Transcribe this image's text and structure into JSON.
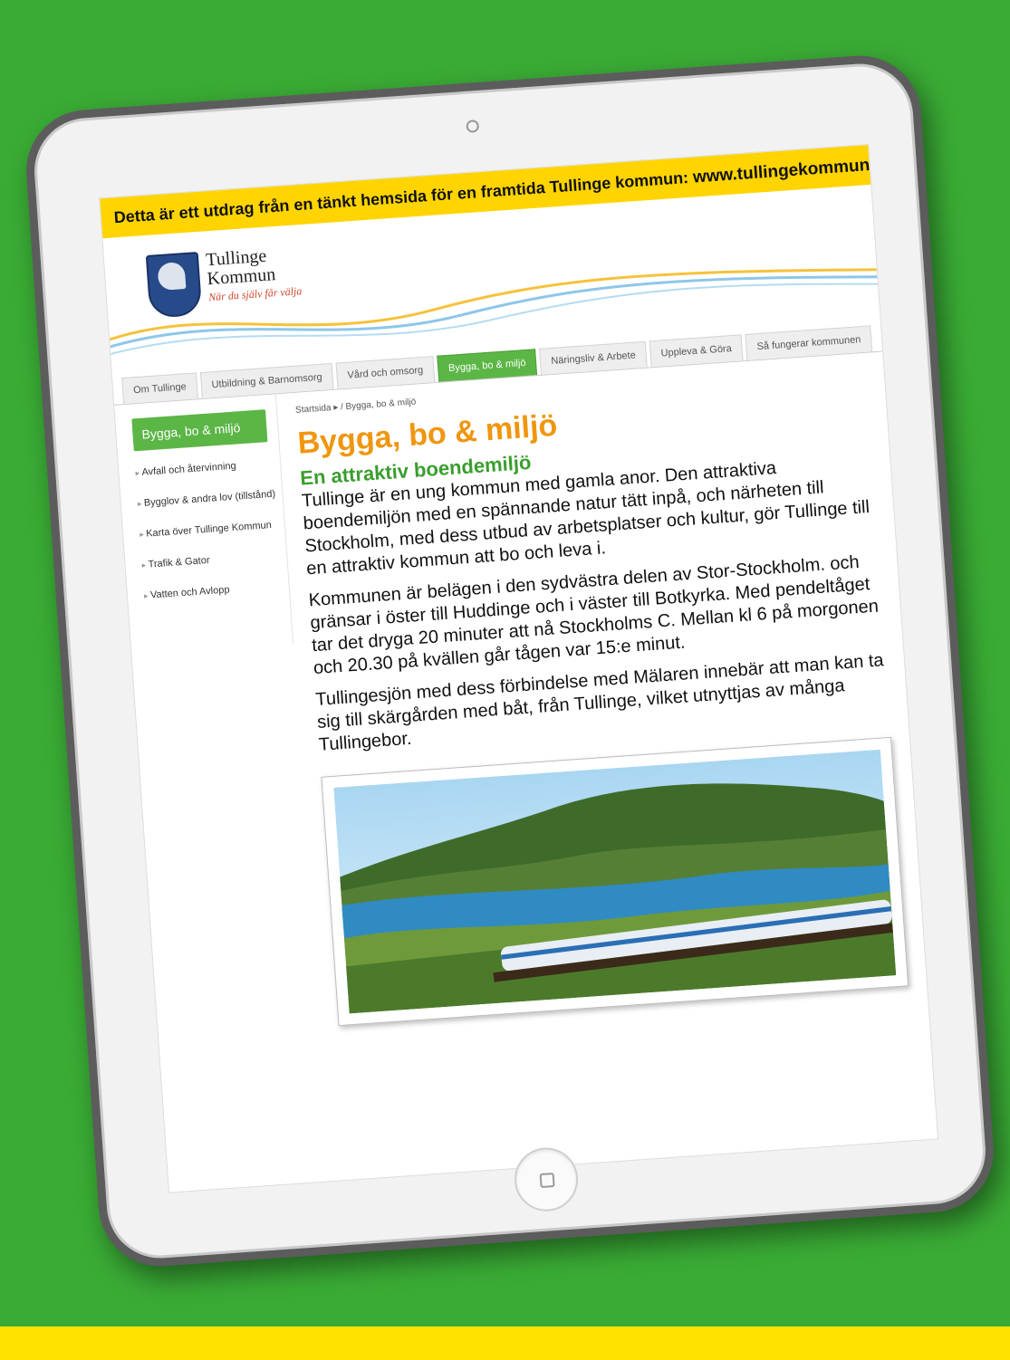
{
  "notice": {
    "text": "Detta är ett utdrag från en tänkt hemsida för en framtida Tullinge kommun: ",
    "url": "www.tullingekommun.se"
  },
  "logo": {
    "line1": "Tullinge",
    "line2": "Kommun",
    "tagline": "När du själv får välja"
  },
  "nav": {
    "tabs": [
      {
        "label": "Om Tullinge"
      },
      {
        "label": "Utbildning & Barnomsorg"
      },
      {
        "label": "Vård och omsorg"
      },
      {
        "label": "Bygga, bo & miljö",
        "active": true
      },
      {
        "label": "Näringsliv & Arbete"
      },
      {
        "label": "Uppleva & Göra"
      },
      {
        "label": "Så fungerar kommunen"
      }
    ]
  },
  "sidebar": {
    "header": "Bygga, bo & miljö",
    "items": [
      "Avfall och återvinning",
      "Bygglov & andra lov (tillstånd)",
      "Karta över Tullinge Kommun",
      "Trafik & Gator",
      "Vatten och Avlopp"
    ]
  },
  "breadcrumb": "Startsida ▸ / Bygga, bo & miljö",
  "main": {
    "title": "Bygga, bo & miljö",
    "subtitle": "En attraktiv boendemiljö",
    "paragraphs": [
      "Tullinge är en ung kommun med gamla anor. Den attraktiva boendemiljön med en spännande natur tätt inpå, och närheten till Stockholm, med dess utbud av arbetsplatser och kultur, gör Tullinge till en attraktiv kommun att bo och leva i.",
      "Kommunen är belägen i den sydvästra delen av Stor-Stockholm. och gränsar i öster till Huddinge och i väster till Botkyrka. Med pendeltåget tar det dryga 20 minuter att nå Stockholms C. Mellan kl 6 på morgonen och 20.30 på kvällen går tågen var 15:e minut.",
      "Tullingesjön med dess förbindelse med Mälaren innebär att man kan ta sig till skärgården med båt, från Tullinge, vilket utnyttjas av många Tullingebor."
    ]
  },
  "colors": {
    "background": "#3aac35",
    "accent_orange": "#f0960e",
    "accent_green": "#5bb646",
    "notice_yellow": "#ffd400"
  }
}
